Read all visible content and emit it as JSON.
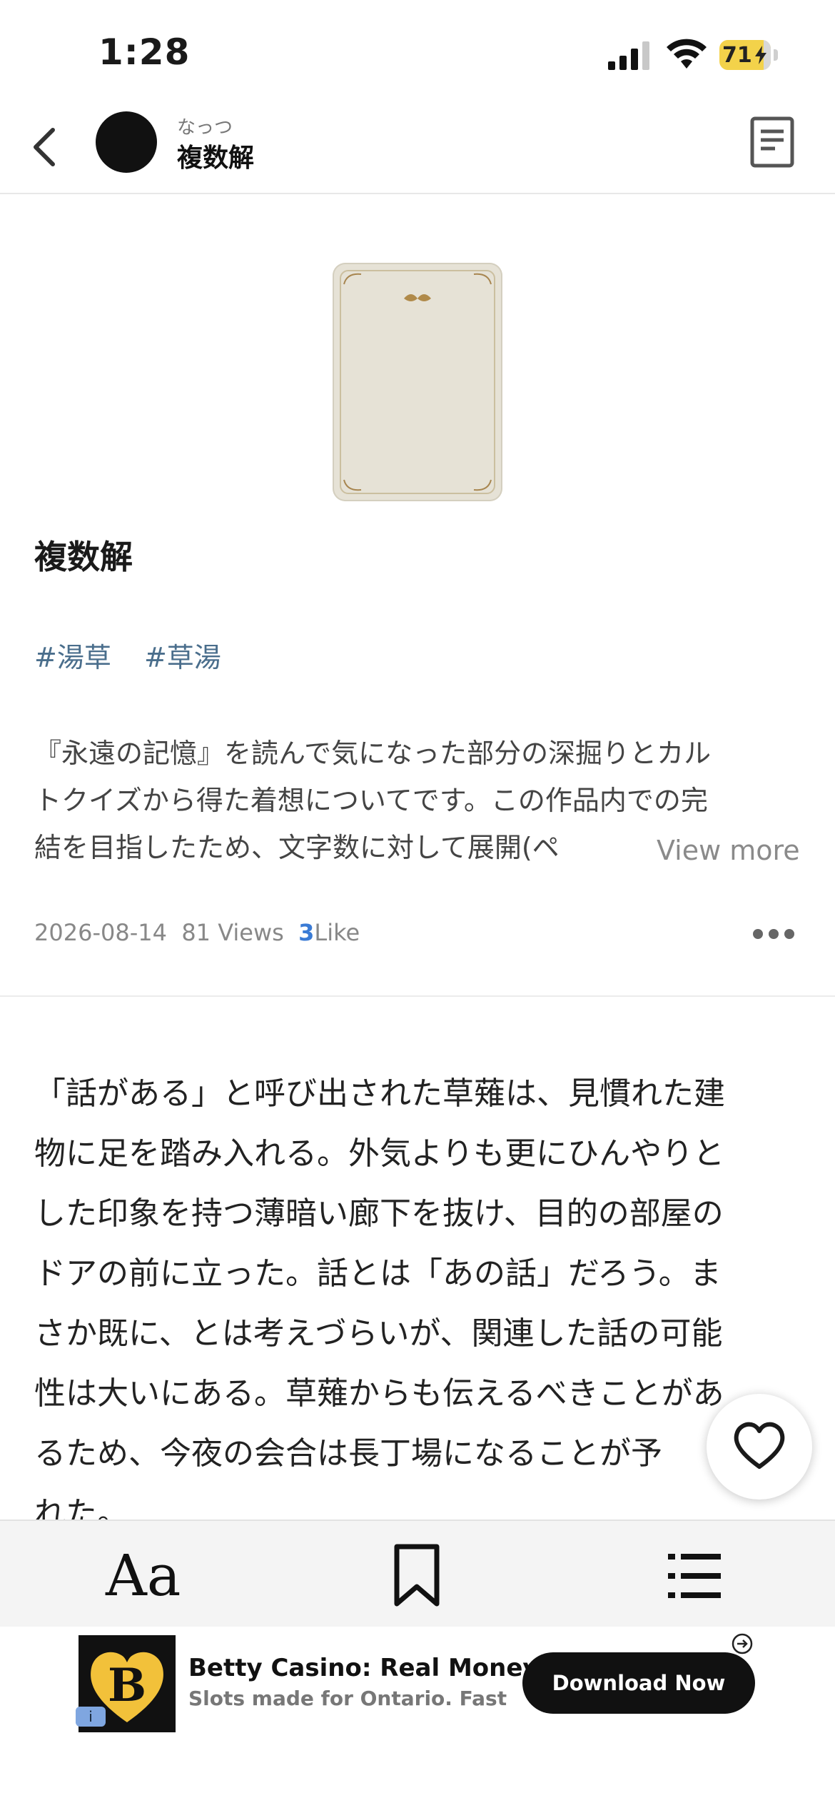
{
  "status_bar": {
    "time": "1:28",
    "battery": "71"
  },
  "header": {
    "author": "なっつ",
    "title": "複数解"
  },
  "work": {
    "title": "複数解",
    "tags": [
      "#湯草",
      "#草湯"
    ],
    "description_lines": [
      "『永遠の記憶』を読んで気になった部分の深掘りとカル",
      "トクイズから得た着想についてです。この作品内での完",
      "結を目指したため、文字数に対して展開(ペ"
    ],
    "view_more": "View more",
    "date": "2026-08-14",
    "views": "81 Views",
    "like_count": "3",
    "like_label": "Like"
  },
  "body": {
    "lines": [
      "「話がある」と呼び出された草薙は、見慣れた建",
      "物に足を踏み入れる。外気よりも更にひんやりと",
      "した印象を持つ薄暗い廊下を抜け、目的の部屋の",
      "ドアの前に立った。話とは「あの話」だろう。ま",
      "さか既に、とは考えづらいが、関連した話の可能",
      "性は大いにある。草薙からも伝えるべきことがあ",
      "るため、今夜の会合は長丁場になることが予",
      "れた。"
    ]
  },
  "toolbar": {
    "font_label": "Aa"
  },
  "ad": {
    "title": "Betty Casino: Real Money",
    "subtitle": "Slots made for Ontario. Fast W...",
    "cta": "Download Now",
    "logo_letter": "B",
    "info": "i"
  },
  "colors": {
    "tag": "#4a6e8c",
    "like": "#3a7bd5",
    "battery": "#f3d24a"
  }
}
